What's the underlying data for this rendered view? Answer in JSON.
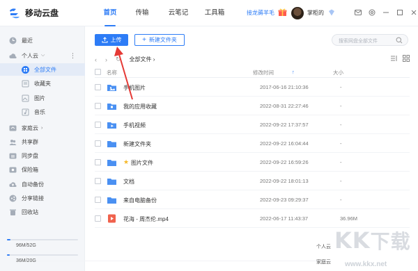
{
  "app": {
    "title": "移动云盘"
  },
  "nav": [
    {
      "label": "首页",
      "active": true
    },
    {
      "label": "传输",
      "active": false
    },
    {
      "label": "云笔记",
      "active": false
    },
    {
      "label": "工具箱",
      "active": false
    }
  ],
  "header": {
    "promo": "接龙薅羊毛",
    "username": "掌柜的"
  },
  "sidebar": {
    "recent": "最近",
    "personal_cloud": "个人云",
    "all_files": "全部文件",
    "favorites": "收藏夹",
    "images": "图片",
    "music": "音乐",
    "family_cloud": "家庭云",
    "share_group": "共享群",
    "sync_disk": "同步盘",
    "safe_box": "保险箱",
    "auto_backup": "自动备份",
    "share_link": "分享链接",
    "recycle_bin": "回收站",
    "quota_personal": {
      "used": "96M/52G",
      "label": "个人云",
      "fraction": 0.05
    },
    "quota_family": {
      "used": "36M/20G",
      "label": "家庭云",
      "fraction": 0.04
    }
  },
  "toolbar": {
    "upload": "上传",
    "new_folder": "新建文件夹",
    "search_placeholder": "搜索网盘全部文件"
  },
  "breadcrumb": {
    "current": "全部文件"
  },
  "table": {
    "col_name": "名称",
    "col_modified": "修改时间",
    "col_size": "大小",
    "rows": [
      {
        "name": "手机图片",
        "icon": "image-folder-icon",
        "date": "2017-06-16 21:10:36",
        "size": "-"
      },
      {
        "name": "我的应用收藏",
        "icon": "app-folder-icon",
        "date": "2022-08-31 22:27:46",
        "size": "-"
      },
      {
        "name": "手机视频",
        "icon": "video-folder-icon",
        "date": "2022-09-22 17:37:57",
        "size": "-"
      },
      {
        "name": "新建文件夹",
        "icon": "folder-icon",
        "date": "2022-09-22 16:04:44",
        "size": "-"
      },
      {
        "name": "图片文件",
        "icon": "folder-icon",
        "starred": true,
        "date": "2022-09-22 16:59:26",
        "size": "-"
      },
      {
        "name": "文档",
        "icon": "folder-icon",
        "date": "2022-09-22 18:01:13",
        "size": "-"
      },
      {
        "name": "来自电脑备份",
        "icon": "folder-icon",
        "date": "2022-09-23 09:29:37",
        "size": "-"
      },
      {
        "name": "花海 - 周杰伦.mp4",
        "icon": "video-file-icon",
        "date": "2022-06-17 11:43:37",
        "size": "36.96M"
      }
    ]
  },
  "watermark": {
    "text": "KK下载",
    "url": "www.kkx.net"
  },
  "colors": {
    "accent": "#2d7cf6",
    "sidebar_bg": "#f4f6f9",
    "star": "#f6b826",
    "arrow": "#e53935"
  }
}
